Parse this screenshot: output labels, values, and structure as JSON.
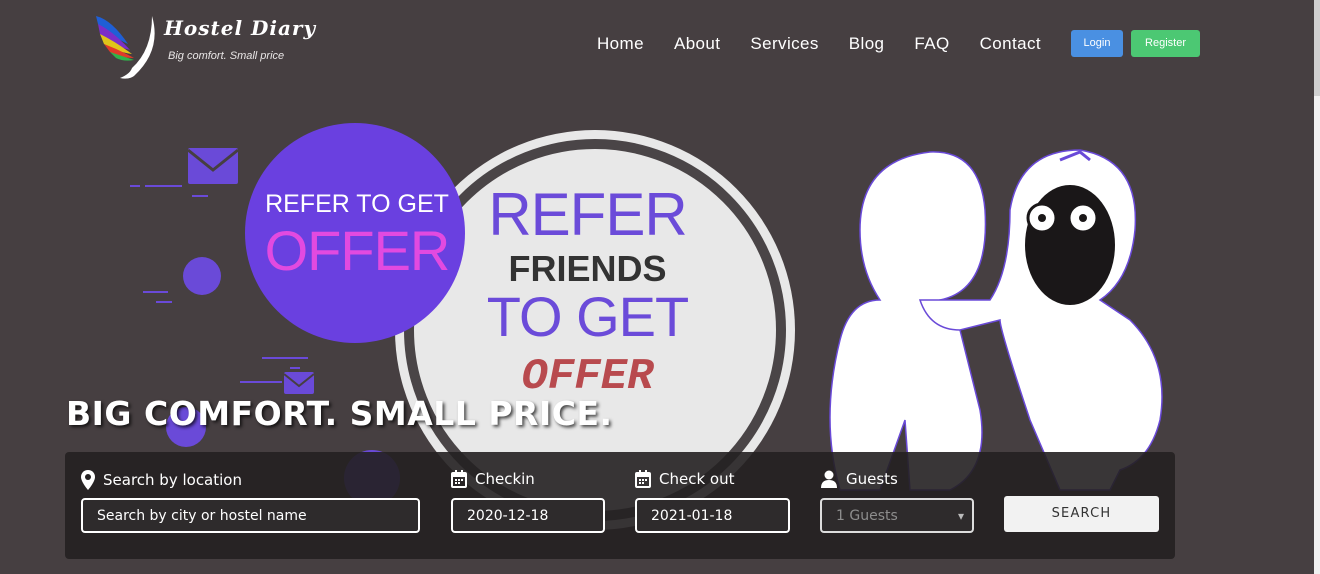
{
  "logo": {
    "title": "Hostel Diary",
    "tagline": "Big comfort. Small price"
  },
  "nav": {
    "items": [
      "Home",
      "About",
      "Services",
      "Blog",
      "FAQ",
      "Contact"
    ]
  },
  "auth": {
    "login_label": "Login",
    "register_label": "Register"
  },
  "hero": {
    "badge_line1": "REFER TO GET",
    "badge_line2": "OFFER",
    "circle_line1": "REFER",
    "circle_line2": "FRIENDS",
    "circle_line3": "TO GET",
    "circle_line4": "OFFER",
    "headline": "BIG COMFORT. SMALL PRICE."
  },
  "search": {
    "location_label": "Search by location",
    "location_placeholder": "Search by city or hostel name",
    "checkin_label": "Checkin",
    "checkin_value": "2020-12-18",
    "checkout_label": "Check out",
    "checkout_value": "2021-01-18",
    "guests_label": "Guests",
    "guests_value": "1 Guests",
    "button_label": "SEARCH"
  },
  "colors": {
    "background": "#463f41",
    "login": "#4a90e2",
    "register": "#4cc873",
    "accent_purple": "#6b4bd9"
  }
}
